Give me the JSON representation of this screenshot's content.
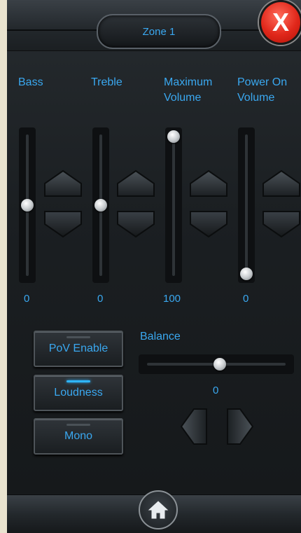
{
  "header": {
    "zone_title": "Zone 1",
    "close_label": "X"
  },
  "sliders": [
    {
      "label": "Bass",
      "value": "0",
      "level": 0.5
    },
    {
      "label": "Treble",
      "value": "0",
      "level": 0.5
    },
    {
      "label": "Maximum Volume",
      "label_line1": "Maximum",
      "label_line2": "Volume",
      "value": "100",
      "level": 1.0
    },
    {
      "label": "Power On Volume",
      "label_line1": "Power On",
      "label_line2": "Volume",
      "value": "0",
      "level": 0.0
    }
  ],
  "toggles": {
    "pov_enable": {
      "label": "PoV Enable",
      "active": false
    },
    "loudness": {
      "label": "Loudness",
      "active": true
    },
    "mono": {
      "label": "Mono",
      "active": false
    }
  },
  "balance": {
    "label": "Balance",
    "value": "0",
    "level": 0.5
  },
  "icons": {
    "close": "close-icon",
    "home": "home-icon",
    "up": "arrow-up-icon",
    "down": "arrow-down-icon",
    "left": "arrow-left-icon",
    "right": "arrow-right-icon"
  },
  "colors": {
    "accent": "#3aa8f0",
    "close": "#e0271a"
  }
}
